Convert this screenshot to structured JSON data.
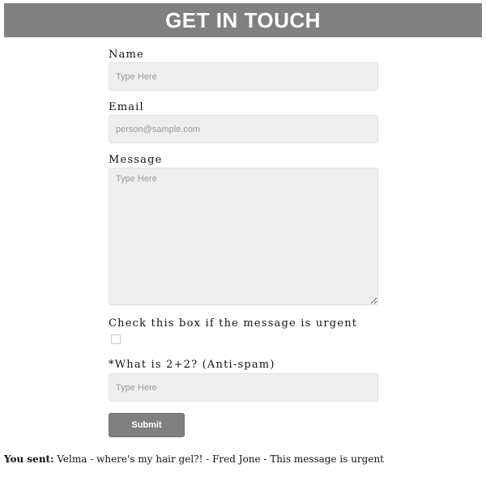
{
  "header": {
    "title": "GET IN TOUCH"
  },
  "form": {
    "name": {
      "label": "Name",
      "placeholder": "Type Here",
      "value": ""
    },
    "email": {
      "label": "Email",
      "placeholder": "person@sample.com",
      "value": ""
    },
    "message": {
      "label": "Message",
      "placeholder": "Type Here",
      "value": ""
    },
    "urgent": {
      "label": "Check this box if the message is urgent",
      "checked": false
    },
    "antispam": {
      "label": "*What is 2+2? (Anti-spam)",
      "placeholder": "Type Here",
      "value": ""
    },
    "submit_label": "Submit"
  },
  "result": {
    "label": "You sent:",
    "text": "Velma - where's my hair gel?! - Fred Jone - This message is urgent"
  },
  "colors": {
    "header_bg": "#808080",
    "input_bg": "#eeeeee",
    "button_bg": "#808080"
  }
}
